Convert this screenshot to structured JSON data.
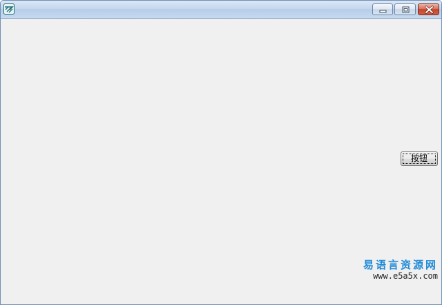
{
  "window": {
    "title": "",
    "icon": "app-logo-icon",
    "caption_buttons": [
      "minimize-icon",
      "maximize-icon",
      "close-icon"
    ],
    "colors": {
      "close_button": "#c5452b",
      "client_background": "#f0f0f0"
    }
  },
  "client": {
    "button_label": "按钮"
  },
  "watermark": {
    "name": "易语言资源网",
    "url": "www.e5a5x.com",
    "color": "#1f8ad6"
  }
}
